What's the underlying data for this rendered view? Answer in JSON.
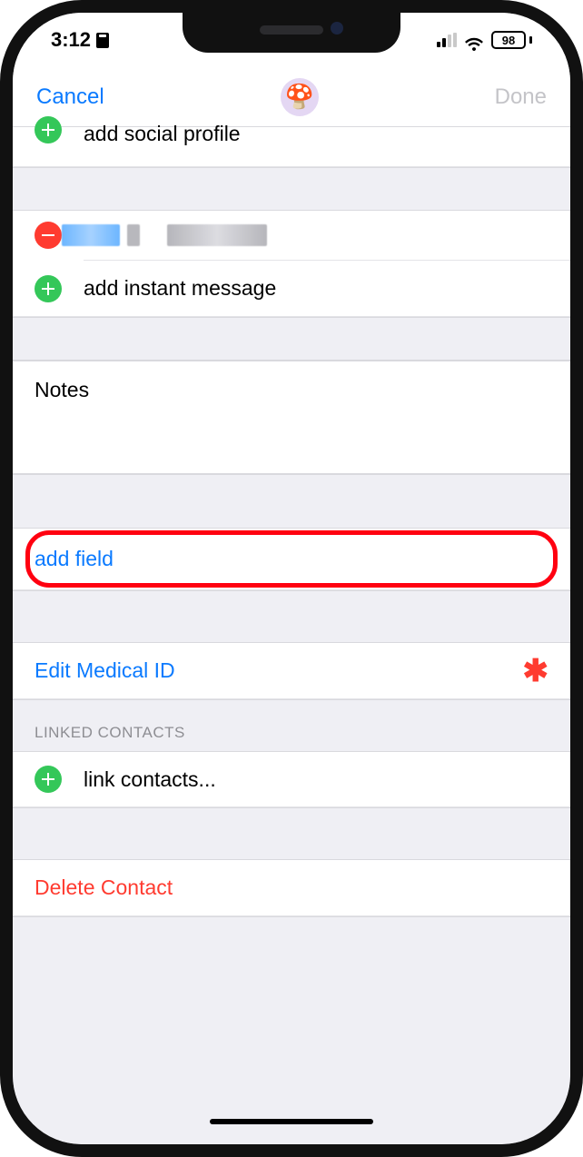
{
  "status": {
    "time": "3:12",
    "battery": "98"
  },
  "nav": {
    "cancel": "Cancel",
    "done": "Done",
    "avatar_emoji": "🍄"
  },
  "rows": {
    "add_social_profile": "add social profile",
    "add_instant_message": "add instant message",
    "notes_label": "Notes",
    "add_field": "add field",
    "edit_medical_id": "Edit Medical ID",
    "linked_contacts_header": "LINKED CONTACTS",
    "link_contacts": "link contacts...",
    "delete_contact": "Delete Contact"
  }
}
